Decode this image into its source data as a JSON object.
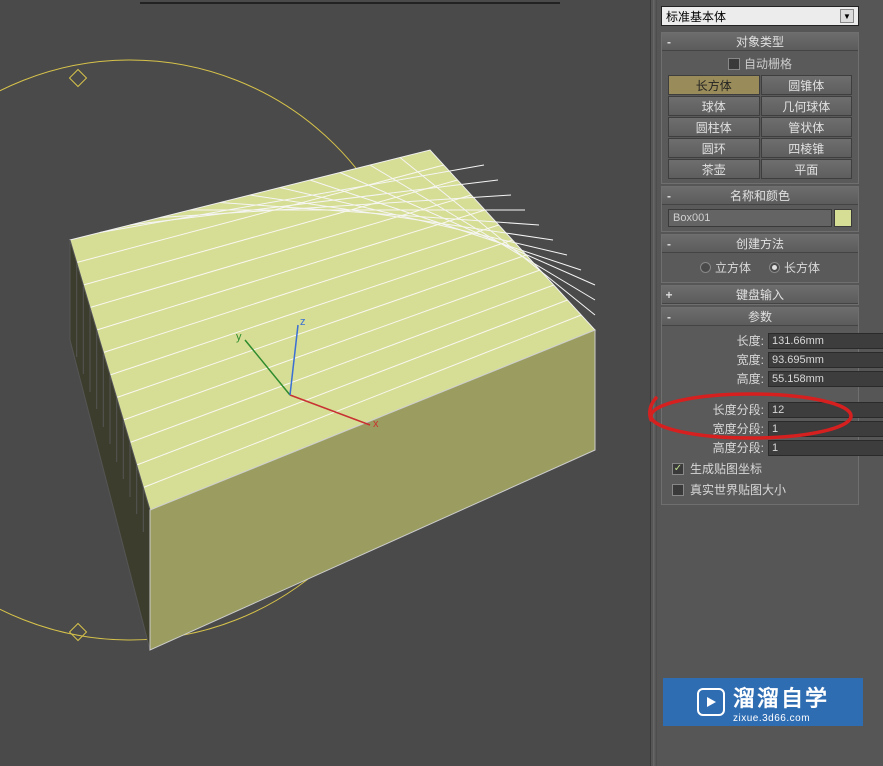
{
  "dropdown": {
    "selected": "标准基本体"
  },
  "object_type": {
    "title": "对象类型",
    "autogrid": "自动栅格",
    "buttons": [
      [
        "长方体",
        "圆锥体"
      ],
      [
        "球体",
        "几何球体"
      ],
      [
        "圆柱体",
        "管状体"
      ],
      [
        "圆环",
        "四棱锥"
      ],
      [
        "茶壶",
        "平面"
      ]
    ],
    "active": "长方体"
  },
  "name_color": {
    "title": "名称和颜色",
    "value": "Box001"
  },
  "creation": {
    "title": "创建方法",
    "opt1": "立方体",
    "opt2": "长方体",
    "selected": "长方体"
  },
  "keyboard_entry": {
    "title": "键盘输入"
  },
  "params": {
    "title": "参数",
    "length_lbl": "长度:",
    "width_lbl": "宽度:",
    "height_lbl": "高度:",
    "length_segs_lbl": "长度分段:",
    "width_segs_lbl": "宽度分段:",
    "height_segs_lbl": "高度分段:",
    "length": "131.66mm",
    "width": "93.695mm",
    "height": "55.158mm",
    "length_segs": "12",
    "width_segs": "1",
    "height_segs": "1",
    "gen_map": "生成贴图坐标",
    "real_world": "真实世界贴图大小"
  },
  "watermark": {
    "brand": "溜溜自学",
    "url": "zixue.3d66.com"
  },
  "chart_data": null
}
